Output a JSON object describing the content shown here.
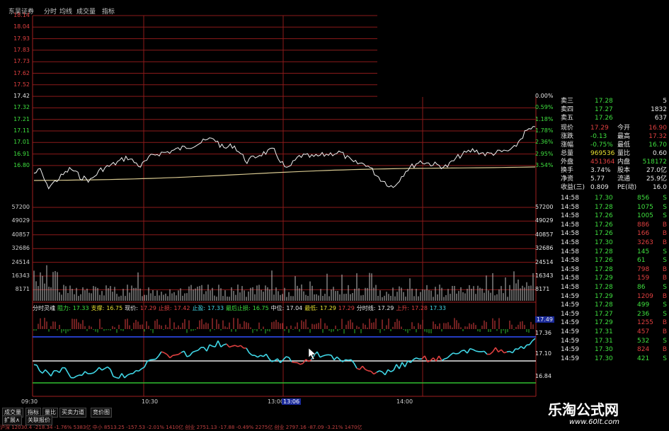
{
  "title_bar": {
    "items": [
      "东吴证券",
      "分时",
      "均线",
      "成交量",
      "指标"
    ]
  },
  "left_axis": {
    "price_ticks": [
      "18.14",
      "18.04",
      "17.93",
      "17.83",
      "17.73",
      "17.62",
      "17.52",
      "17.42",
      "17.32",
      "17.21",
      "17.11",
      "17.01",
      "16.91",
      "16.80"
    ],
    "volume_ticks": [
      "57200",
      "49029",
      "40857",
      "32686",
      "24514",
      "16343",
      "8171"
    ],
    "time_ticks": [
      "09:30",
      "10:30",
      "13:00",
      "14:00"
    ]
  },
  "right_axis": {
    "pct_ticks": [
      "0.00%",
      "0.59%",
      "1.18%",
      "1.78%",
      "2.36%",
      "2.95%",
      "3.54%"
    ],
    "volume_ticks": [
      "57200",
      "49029",
      "40857",
      "32686",
      "24514",
      "16343",
      "8171"
    ],
    "indicator_ticks": [
      "17.49",
      "17.36",
      "17.10",
      "16.84"
    ],
    "current_price_tag": "17.49"
  },
  "indicator_header": [
    {
      "label": "分时灵魂",
      "color": "#e8e8e8"
    },
    {
      "label": "阻力:",
      "color": "#3fe03f"
    },
    {
      "label": "17.33",
      "color": "#3fe03f"
    },
    {
      "label": "支撑:",
      "color": "#e8e030"
    },
    {
      "label": "16.75",
      "color": "#e8e030"
    },
    {
      "label": "现价:",
      "color": "#e8e8e8"
    },
    {
      "label": "17.29",
      "color": "#e04040"
    },
    {
      "label": "止损:",
      "color": "#e04040"
    },
    {
      "label": "17.42",
      "color": "#e04040"
    },
    {
      "label": "止盈:",
      "color": "#40d8e8"
    },
    {
      "label": "17.33",
      "color": "#40d8e8"
    },
    {
      "label": "最后止损:",
      "color": "#3fe03f"
    },
    {
      "label": "16.75",
      "color": "#3fe03f"
    },
    {
      "label": "中位:",
      "color": "#e8e8e8"
    },
    {
      "label": "17.04",
      "color": "#e8e8e8"
    },
    {
      "label": "最低:",
      "color": "#e8e030"
    },
    {
      "label": "17.29",
      "color": "#e8e030"
    },
    {
      "label": "17.29",
      "color": "#e04040"
    },
    {
      "label": "分时线:",
      "color": "#e8e8e8"
    },
    {
      "label": "17.29",
      "color": "#e8e8e8"
    },
    {
      "label": "上升:",
      "color": "#e04040"
    },
    {
      "label": "17.28",
      "color": "#e04040"
    },
    {
      "label": "17.33",
      "color": "#40d8e8"
    }
  ],
  "quote": {
    "asks": [
      {
        "label": "卖三",
        "price": "17.28",
        "vol": "5"
      },
      {
        "label": "卖四",
        "price": "17.27",
        "vol": "1832"
      },
      {
        "label": "卖五",
        "price": "17.26",
        "vol": "637"
      }
    ],
    "stats": [
      {
        "l1": "现价",
        "v1": "17.29",
        "l2": "今开",
        "v2": "16.90"
      },
      {
        "l1": "涨跌",
        "v1": "-0.13",
        "l2": "最高",
        "v2": "17.32"
      },
      {
        "l1": "涨幅",
        "v1": "-0.75%",
        "l2": "最低",
        "v2": "16.70"
      },
      {
        "l1": "总量",
        "v1": "969536",
        "l2": "量比",
        "v2": "0.60"
      },
      {
        "l1": "外盘",
        "v1": "451364",
        "l2": "内盘",
        "v2": "518172"
      },
      {
        "l1": "换手",
        "v1": "3.74%",
        "l2": "股本",
        "v2": "27.0亿"
      },
      {
        "l1": "净资",
        "v1": "5.77",
        "l2": "流通",
        "v2": "25.9亿"
      },
      {
        "l1": "收益(三)",
        "v1": "0.809",
        "l2": "PE(动)",
        "v2": "16.0"
      }
    ],
    "trades": [
      {
        "t": "14:58",
        "p": "17.30",
        "v": "856",
        "s": "S"
      },
      {
        "t": "14:58",
        "p": "17.28",
        "v": "1075",
        "s": "S"
      },
      {
        "t": "14:58",
        "p": "17.26",
        "v": "1005",
        "s": "S"
      },
      {
        "t": "14:58",
        "p": "17.26",
        "v": "886",
        "s": "B"
      },
      {
        "t": "14:58",
        "p": "17.26",
        "v": "166",
        "s": "B"
      },
      {
        "t": "14:58",
        "p": "17.30",
        "v": "3263",
        "s": "B"
      },
      {
        "t": "14:58",
        "p": "17.28",
        "v": "145",
        "s": "S"
      },
      {
        "t": "14:58",
        "p": "17.26",
        "v": "61",
        "s": "S"
      },
      {
        "t": "14:58",
        "p": "17.28",
        "v": "798",
        "s": "B"
      },
      {
        "t": "14:58",
        "p": "17.29",
        "v": "159",
        "s": "B"
      },
      {
        "t": "14:58",
        "p": "17.28",
        "v": "86",
        "s": "S"
      },
      {
        "t": "14:59",
        "p": "17.29",
        "v": "1209",
        "s": "B"
      },
      {
        "t": "14:59",
        "p": "17.28",
        "v": "499",
        "s": "S"
      },
      {
        "t": "14:59",
        "p": "17.27",
        "v": "236",
        "s": "S"
      },
      {
        "t": "14:59",
        "p": "17.29",
        "v": "1255",
        "s": "B"
      },
      {
        "t": "14:59",
        "p": "17.31",
        "v": "457",
        "s": "B"
      },
      {
        "t": "14:59",
        "p": "17.31",
        "v": "532",
        "s": "S"
      },
      {
        "t": "14:59",
        "p": "17.30",
        "v": "824",
        "s": "B"
      },
      {
        "t": "14:59",
        "p": "17.30",
        "v": "421",
        "s": "S"
      }
    ]
  },
  "time_marker": "13:06",
  "bottom_tabs": [
    "成交量",
    "指标",
    "量比",
    "买卖力道",
    "竞价图"
  ],
  "bottom_tabs_row2": [
    "扩展∧",
    "关联报价"
  ],
  "status_bar": "沪深 12030.4  -218.34  -1.76%   5383亿    中小 8513.25 -157.53 -2.01%   1410亿   创业 2751.13 -17.88 -0.49%   2275亿   创业 2797.16 -87.09 -3.21%   1470亿",
  "watermark": {
    "title": "乐淘公式网",
    "url": "www.60lt.com"
  },
  "colors": {
    "up": "#e04040",
    "down": "#3fe03f",
    "grid": "#8b1a1a",
    "avg_line": "#d8c890",
    "price_line": "#f0f0f0"
  }
}
